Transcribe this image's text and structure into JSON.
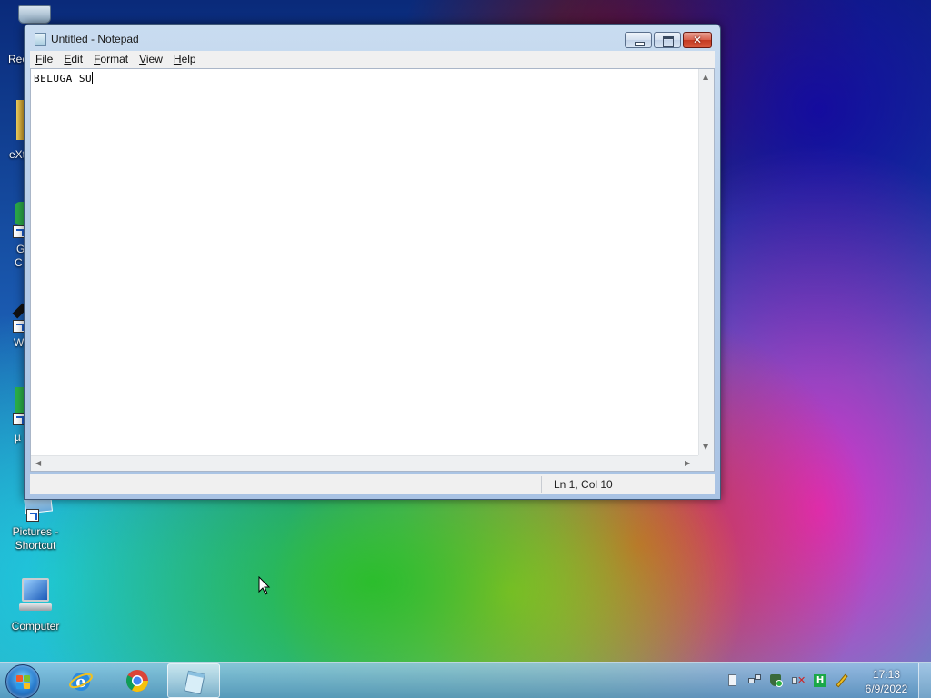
{
  "desktop": {
    "partial_icons": [
      {
        "label": "Rec"
      },
      {
        "label": "eXt"
      },
      {
        "label": "G\nC"
      },
      {
        "label": "W"
      },
      {
        "label": "µ"
      }
    ],
    "icons": [
      {
        "label": "Pictures - Shortcut",
        "icon": "pictures-folder-icon"
      },
      {
        "label": "Computer",
        "icon": "computer-icon"
      }
    ]
  },
  "window": {
    "title": "Untitled - Notepad",
    "menu": [
      {
        "label": "File",
        "accel": "F",
        "rest": "ile"
      },
      {
        "label": "Edit",
        "accel": "E",
        "rest": "dit"
      },
      {
        "label": "Format",
        "accel": "F",
        "rest": "ormat"
      },
      {
        "label": "View",
        "accel": "V",
        "rest": "iew"
      },
      {
        "label": "Help",
        "accel": "H",
        "rest": "elp"
      }
    ],
    "content": "BELUGA SU",
    "status": "Ln 1, Col 10"
  },
  "taskbar": {
    "pinned": [
      "internet-explorer-icon",
      "chrome-icon",
      "notepad-icon"
    ],
    "active": "notepad-icon",
    "clock": {
      "time": "17:13",
      "date": "6/9/2022"
    }
  }
}
